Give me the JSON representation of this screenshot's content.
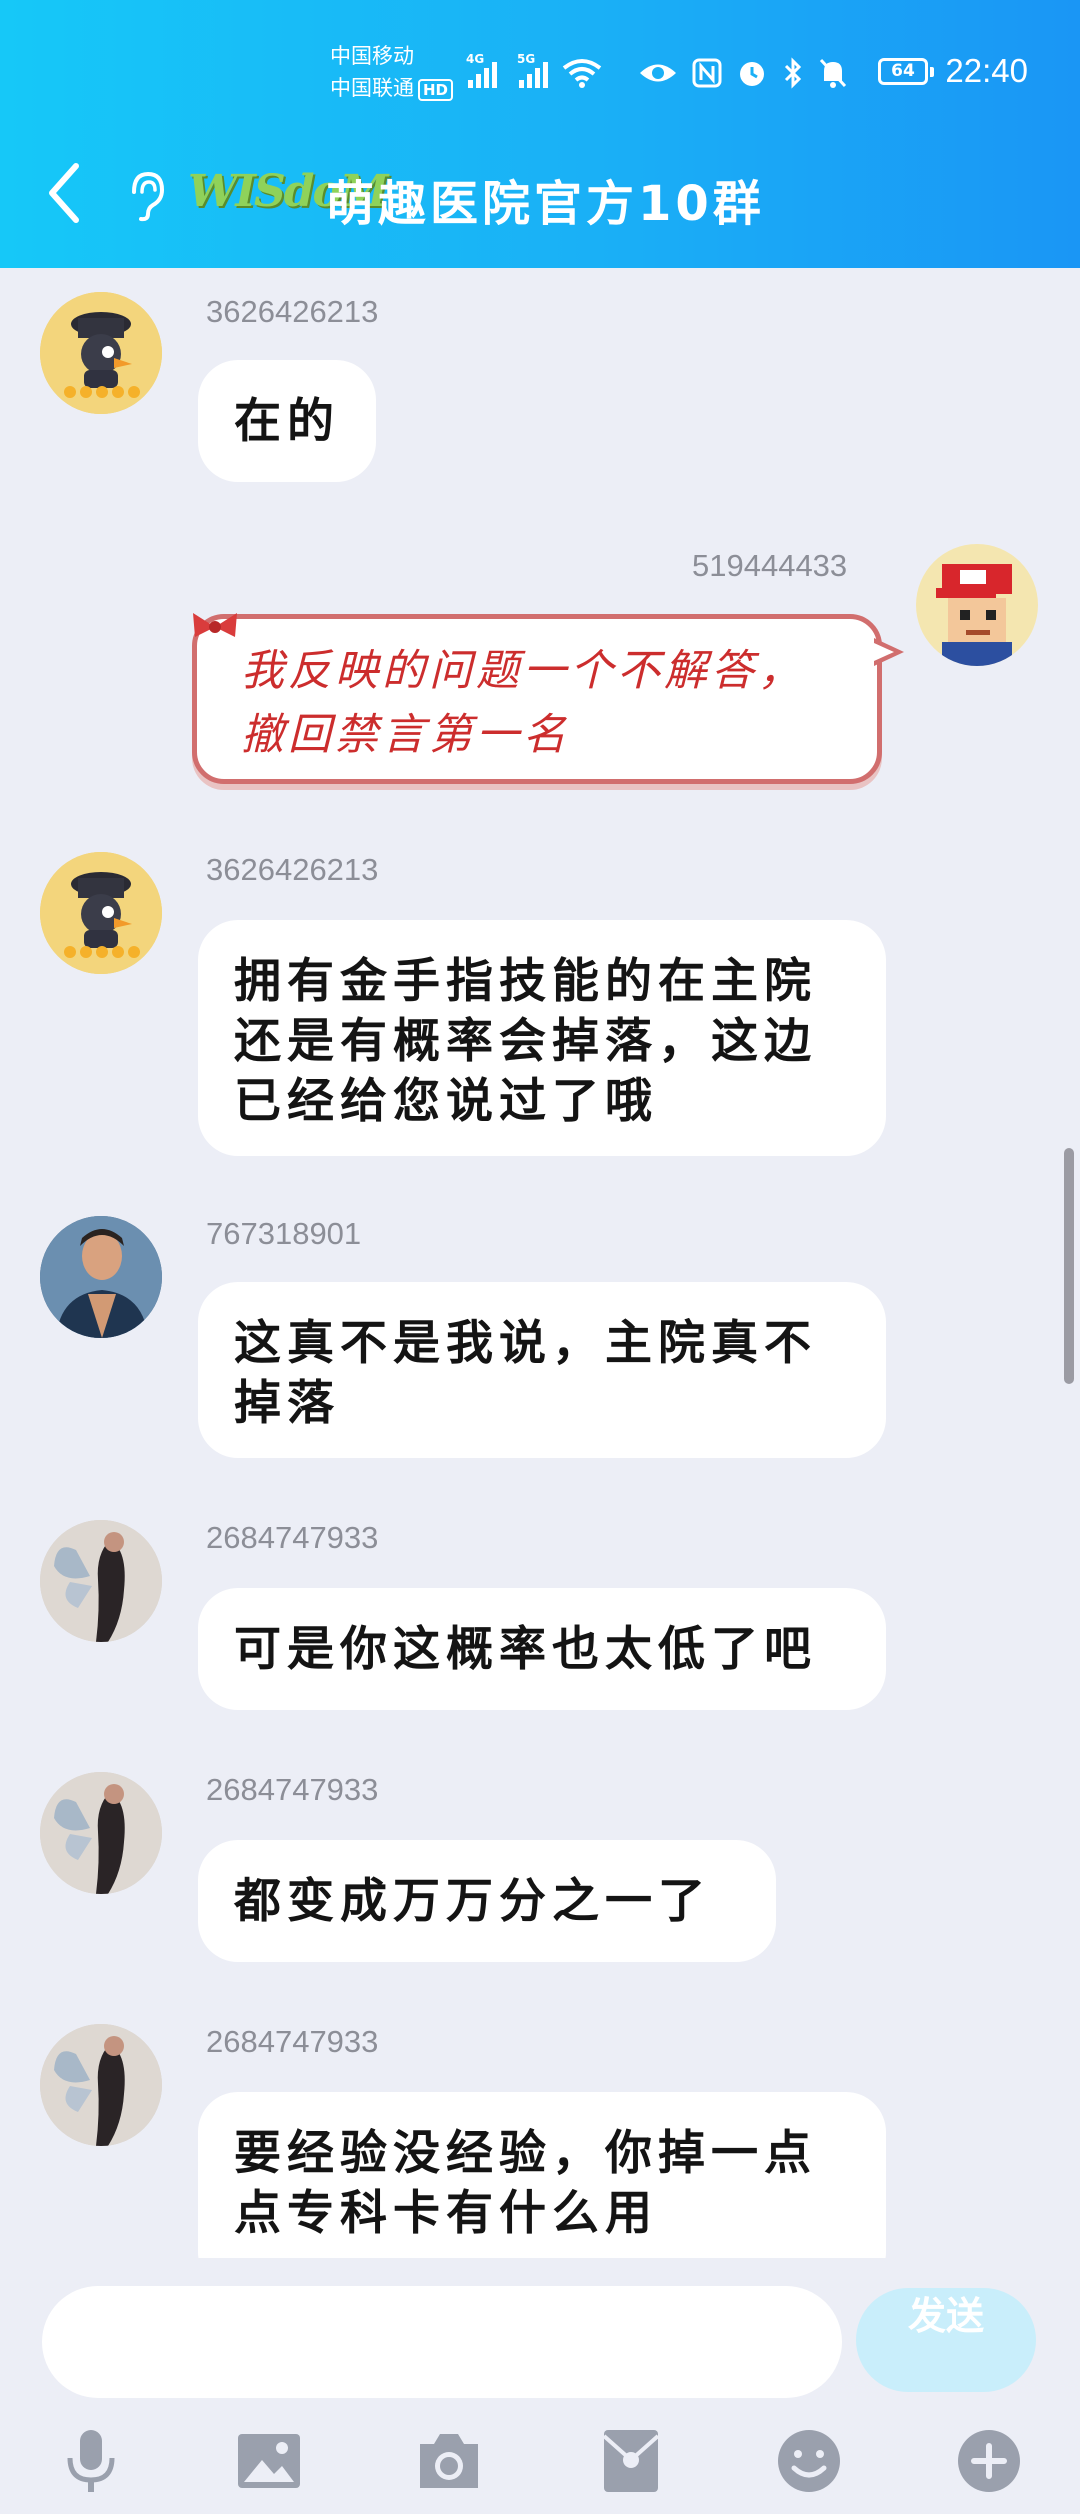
{
  "status_bar": {
    "carrier_1": "中国移动",
    "carrier_2": "中国联通",
    "hd_badge": "HD",
    "net_1": "4G",
    "net_2": "5G",
    "battery": "64",
    "time": "22:40"
  },
  "header": {
    "logo_text": "WISdoM",
    "title": "萌趣医院官方10群"
  },
  "messages": [
    {
      "user": "3626426213",
      "text": "在的"
    },
    {
      "user": "519444433",
      "text": "我反映的问题一个不解答，撤回禁言第一名"
    },
    {
      "user": "3626426213",
      "text": "拥有金手指技能的在主院还是有概率会掉落，这边已经给您说过了哦"
    },
    {
      "user": "767318901",
      "text": "这真不是我说，主院真不掉落"
    },
    {
      "user": "2684747933",
      "text": "可是你这概率也太低了吧"
    },
    {
      "user": "2684747933",
      "text": "都变成万万分之一了"
    },
    {
      "user": "2684747933",
      "text": "要经验没经验，你掉一点点专科卡有什么用"
    }
  ],
  "input": {
    "placeholder": "",
    "value": ""
  },
  "send_button": "发送",
  "toolbar": [
    "mic-icon",
    "image-icon",
    "camera-icon",
    "red-packet-icon",
    "emoji-icon",
    "plus-icon"
  ],
  "colors": {
    "header_start": "#16c8f8",
    "header_end": "#1a96f5",
    "background": "#eceef6",
    "send_disabled": "#c9eefb"
  }
}
